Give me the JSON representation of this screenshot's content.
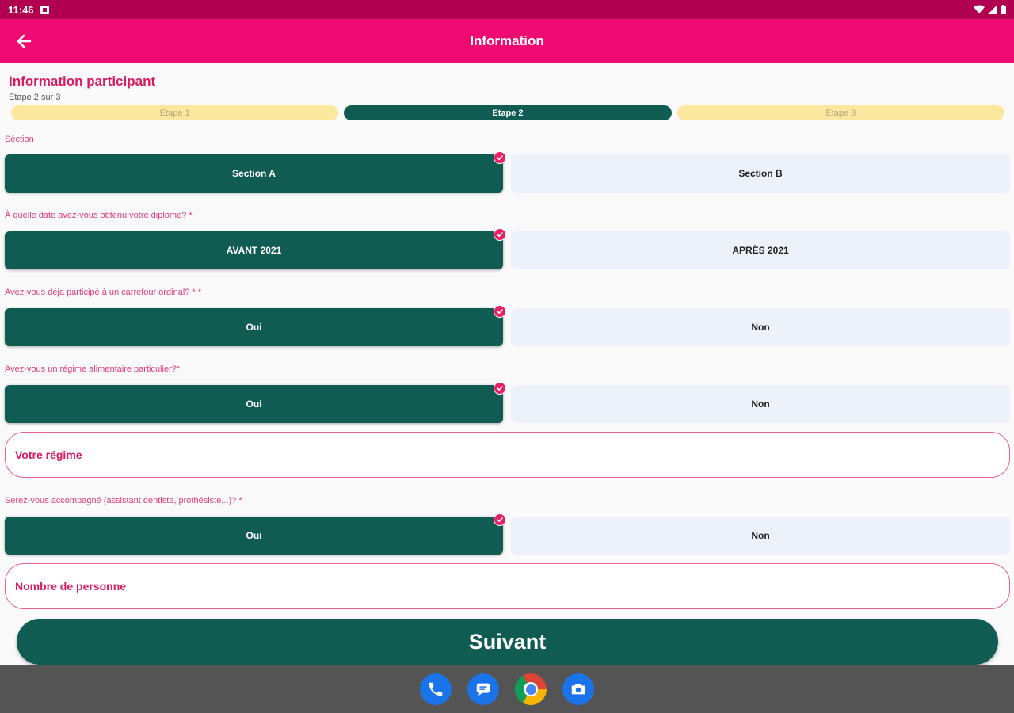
{
  "status_bar": {
    "time": "11:46"
  },
  "app_bar": {
    "title": "Information",
    "back_icon": "arrow-left-icon"
  },
  "header": {
    "title": "Information participant",
    "subtitle": "Etape 2 sur 3"
  },
  "steps": [
    {
      "label": "Etape 1",
      "state": "inactive"
    },
    {
      "label": "Etape 2",
      "state": "active"
    },
    {
      "label": "Etape 3",
      "state": "inactive"
    }
  ],
  "questions": [
    {
      "label": "Séction",
      "left": "Section A",
      "right": "Section B",
      "selected": "left"
    },
    {
      "label": "À quelle date avez-vous obtenu votre diplôme? *",
      "left": "AVANT 2021",
      "right": "APRÈS 2021",
      "selected": "left"
    },
    {
      "label": "Avez-vous déja participé à un carrefour ordinal? * *",
      "left": "Oui",
      "right": "Non",
      "selected": "left"
    },
    {
      "label": "Avez-vous un régime alimentaire particulier?*",
      "left": "Oui",
      "right": "Non",
      "selected": "left"
    },
    {
      "label": "Serez-vous accompagné (assistant dentiste, prothésiste,..)? *",
      "left": "Oui",
      "right": "Non",
      "selected": "left"
    }
  ],
  "fields": {
    "regime": {
      "placeholder": "Votre régime",
      "value": ""
    },
    "nombre": {
      "placeholder": "Nombre de personne",
      "value": ""
    }
  },
  "next_button": {
    "label": "Suivant"
  },
  "dock": [
    "phone-icon",
    "messages-icon",
    "chrome-icon",
    "camera-icon"
  ],
  "colors": {
    "status_bar": "#b0004f",
    "app_bar": "#ef0a72",
    "primary_green": "#115c52",
    "accent_pink": "#e91e63",
    "step_inactive": "#fbe79e",
    "option_unselected": "#edf1fa"
  }
}
